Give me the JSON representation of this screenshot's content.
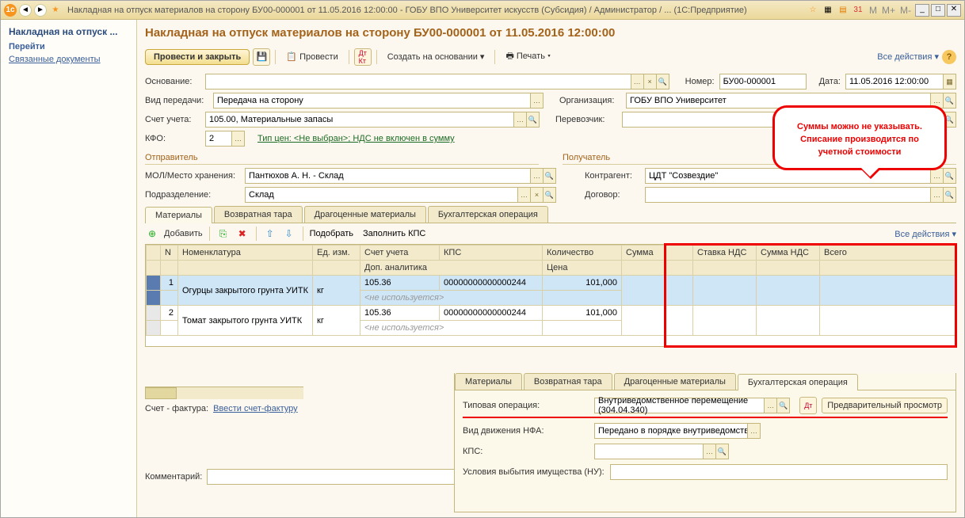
{
  "title_bar": {
    "text": "Накладная на отпуск материалов на сторону БУ00-000001 от 11.05.2016 12:00:00 - ГОБУ ВПО Университет искусств (Субсидия) / Администратор / ... (1С:Предприятие)",
    "m_buttons": [
      "M",
      "M+",
      "M-"
    ]
  },
  "sidebar": {
    "title": "Накладная на отпуск ...",
    "links": [
      "Перейти",
      "Связанные документы"
    ]
  },
  "doc_title": "Накладная на отпуск материалов на сторону БУ00-000001 от 11.05.2016 12:00:00",
  "cmdbar": {
    "post_close": "Провести и закрыть",
    "post": "Провести",
    "create_based": "Создать на основании",
    "print": "Печать",
    "all_actions": "Все действия"
  },
  "fields": {
    "basis_label": "Основание:",
    "number_label": "Номер:",
    "number_value": "БУ00-000001",
    "date_label": "Дата:",
    "date_value": "11.05.2016 12:00:00",
    "transfer_type_label": "Вид передачи:",
    "transfer_type_value": "Передача на сторону",
    "org_label": "Организация:",
    "org_value": "ГОБУ ВПО Университет",
    "account_label": "Счет учета:",
    "account_value": "105.00, Материальные запасы",
    "carrier_label": "Перевозчик:",
    "kfo_label": "КФО:",
    "kfo_value": "2",
    "price_type_link": "Тип цен: <Не выбран>; НДС не включен в сумму",
    "sender_header": "Отправитель",
    "receiver_header": "Получатель",
    "mol_label": "МОЛ/Место хранения:",
    "mol_value": "Пантюхов А. Н. - Склад",
    "contractor_label": "Контрагент:",
    "contractor_value": "ЦДТ \"Созвездие\"",
    "dept_label": "Подразделение:",
    "dept_value": "Склад",
    "contract_label": "Договор:",
    "comment_label": "Комментарий:",
    "invoice_label": "Счет - фактура:",
    "invoice_link": "Ввести счет-фактуру"
  },
  "tabs_upper": [
    "Материалы",
    "Возвратная тара",
    "Драгоценные материалы",
    "Бухгалтерская операция"
  ],
  "tbl_toolbar": {
    "add": "Добавить",
    "pick": "Подобрать",
    "fill_kps": "Заполнить КПС",
    "all_actions": "Все действия"
  },
  "grid": {
    "headers": [
      "N",
      "Номенклатура",
      "Ед. изм.",
      "Счет учета",
      "КПС",
      "Количество",
      "Сумма",
      "Ставка НДС",
      "Сумма НДС",
      "Всего"
    ],
    "subheaders": [
      "",
      "",
      "",
      "Доп. аналитика",
      "",
      "Цена",
      "",
      "",
      "",
      ""
    ],
    "rows": [
      {
        "n": "1",
        "nom": "Огурцы закрытого грунта УИТК",
        "unit": "кг",
        "acc": "105.36",
        "kps": "00000000000000244",
        "qty": "101,000",
        "analytic": "<не используется>"
      },
      {
        "n": "2",
        "nom": "Томат закрытого грунта УИТК",
        "unit": "кг",
        "acc": "105.36",
        "kps": "00000000000000244",
        "qty": "101,000",
        "analytic": "<не используется>"
      }
    ]
  },
  "callout_text": "Суммы можно не указывать. Списание производится по учетной стоимости",
  "tabs_lower": [
    "Материалы",
    "Возвратная тара",
    "Драгоценные материалы",
    "Бухгалтерская операция"
  ],
  "lower": {
    "op_label": "Типовая операция:",
    "op_value": "Внутриведомственное перемещение (304.04.340)",
    "preview": "Предварительный просмотр",
    "nfa_label": "Вид движения НФА:",
    "nfa_value": "Передано в порядке внутриведомстве",
    "kps_label": "КПС:",
    "disposal_label": "Условия выбытия имущества (НУ):"
  }
}
